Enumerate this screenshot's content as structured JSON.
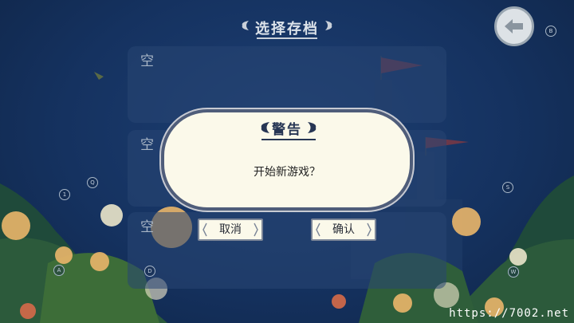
{
  "screen": {
    "title": "选择存档"
  },
  "save_slots": [
    {
      "label": "空"
    },
    {
      "label": "空"
    },
    {
      "label": "空"
    }
  ],
  "back_button": {
    "icon": "back-arrow-icon"
  },
  "key_hints": [
    "B",
    "Q",
    "1",
    "S",
    "A",
    "D",
    "W"
  ],
  "dialog": {
    "title": "警告",
    "message": "开始新游戏？",
    "cancel_label": "取消",
    "confirm_label": "确认"
  },
  "watermark": "https://7002.net",
  "colors": {
    "background": "#153260",
    "dialog_bg": "#fbf9ea",
    "dialog_border": "#4f5d7a",
    "title_text": "#dce3ea",
    "flower_yellow": "#e8b46a"
  }
}
